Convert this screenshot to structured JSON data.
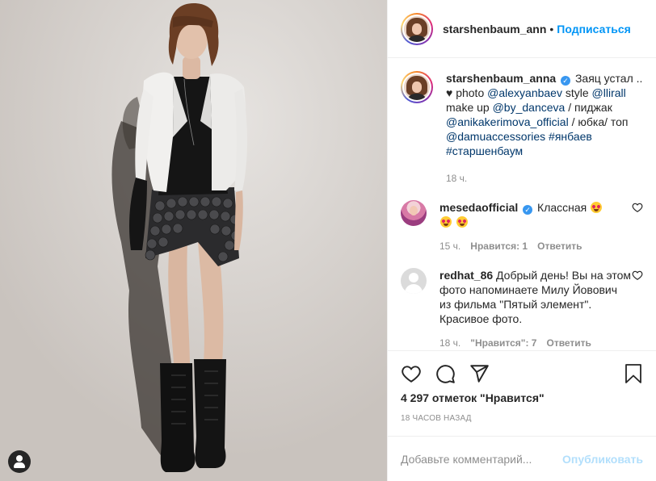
{
  "post": {
    "author": "starshenbaum_ann",
    "follow_label": "Подписаться",
    "separator": "•"
  },
  "caption": {
    "author": "starshenbaum_anna",
    "text_1": "Заяц устал ..",
    "text_2": "photo",
    "mention_1": "@alexyanbaev",
    "text_3": "style",
    "mention_2": "@llirall",
    "text_4": "make up",
    "mention_3": "@by_danceva",
    "text_5": "/ пиджак",
    "mention_4": "@anikakerimova_official",
    "text_6": "/ юбка/ топ",
    "mention_5": "@damuaccessories",
    "hashtag_1": "#янбаев",
    "hashtag_2": "#старшенбаум",
    "time": "18 ч."
  },
  "comments": [
    {
      "author": "mesedaofficial",
      "text": "Классная",
      "time": "15 ч.",
      "likes": "Нравится: 1",
      "reply": "Ответить"
    },
    {
      "author": "redhat_86",
      "text": "Добрый день! Вы на этом фото напоминаете Милу Йовович из фильма \"Пятый элемент\". Красивое фото.",
      "time": "18 ч.",
      "likes": "\"Нравится\": 7",
      "reply": "Ответить"
    }
  ],
  "stats": {
    "likes": "4 297 отметок \"Нравится\"",
    "age": "18 ЧАСОВ НАЗАД"
  },
  "composer": {
    "placeholder": "Добавьте комментарий...",
    "publish_label": "Опубликовать"
  },
  "icons": [
    "heart-icon",
    "comment-icon",
    "share-icon",
    "bookmark-icon",
    "user-tag-icon",
    "verified-icon",
    "heart-eyes-emoji"
  ],
  "colors": {
    "accent": "#0095f6",
    "publish_disabled": "#b2dffc",
    "verified": "#3897f0",
    "muted": "#8e8e8e",
    "link": "#00376b"
  }
}
